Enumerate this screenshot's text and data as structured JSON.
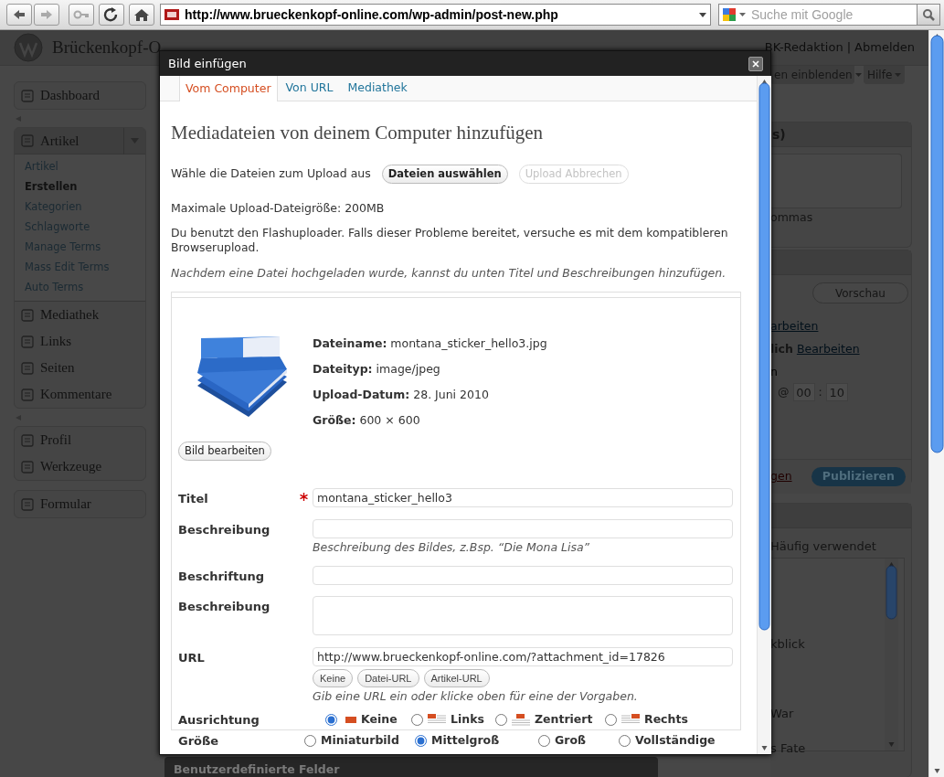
{
  "browser": {
    "buttons": [
      {
        "kind": "back",
        "disabled": false
      },
      {
        "kind": "forward",
        "disabled": true
      },
      {
        "kind": "key",
        "disabled": true
      },
      {
        "kind": "reload",
        "disabled": false
      },
      {
        "kind": "home",
        "disabled": false
      }
    ],
    "url": "http://www.brueckenkopf-online.com/wp-admin/post-new.php",
    "search_placeholder": "Suche mit Google"
  },
  "admin": {
    "site_title": "Brückenkopf-O",
    "user": "BK-Redaktion",
    "separator": "|",
    "logout": "Abmelden"
  },
  "sidebar": {
    "groups": [
      {
        "divider": true,
        "items": [
          {
            "label": "Dashboard",
            "expanded": false
          }
        ]
      },
      {
        "divider": true,
        "items": [
          {
            "label": "Artikel",
            "expanded": true,
            "submenu": [
              {
                "label": "Artikel",
                "selected": false
              },
              {
                "label": "Erstellen",
                "selected": true
              },
              {
                "label": "Kategorien",
                "selected": false
              },
              {
                "label": "Schlagworte",
                "selected": false
              },
              {
                "label": "Manage Terms",
                "selected": false
              },
              {
                "label": "Mass Edit Terms",
                "selected": false
              },
              {
                "label": "Auto Terms",
                "selected": false
              }
            ]
          },
          {
            "label": "Mediathek",
            "expanded": false
          },
          {
            "label": "Links",
            "expanded": false
          },
          {
            "label": "Seiten",
            "expanded": false
          },
          {
            "label": "Kommentare",
            "expanded": false
          }
        ]
      },
      {
        "divider": false,
        "items": [
          {
            "label": "Profil",
            "expanded": false
          },
          {
            "label": "Werkzeuge",
            "expanded": false
          }
        ]
      },
      {
        "divider": false,
        "items": [
          {
            "label": "Formular",
            "expanded": false
          }
        ]
      }
    ]
  },
  "right_column": {
    "screen_options": "en einblenden",
    "help": "Hilfe",
    "tags_box": {
      "title": "s)",
      "hint": "ommas"
    },
    "publish_box": {
      "preview_button": "Vorschau",
      "status_link": "arbeiten",
      "visibility_label": "lich",
      "visibility_link": "Bearbeiten",
      "date_label": "n",
      "time": {
        "at": "@",
        "hour": "00",
        "colon": ":",
        "minute": "10"
      },
      "delete_link": "gen",
      "publish_button": "Publizieren"
    },
    "categories_box": {
      "tab": "Häufig verwendet",
      "items": [
        "kblick",
        "War",
        "s Fate"
      ]
    }
  },
  "bottom_box": {
    "title": "Benutzerdefinierte Felder"
  },
  "dialog": {
    "title": "Bild einfügen",
    "tabs": [
      {
        "label": "Vom Computer",
        "selected": true
      },
      {
        "label": "Von URL",
        "selected": false
      },
      {
        "label": "Mediathek",
        "selected": false
      }
    ],
    "heading": "Mediadateien von deinem Computer hinzufügen",
    "upload": {
      "label": "Wähle die Dateien zum Upload aus",
      "select_button": {
        "label": "Dateien auswählen",
        "disabled": false
      },
      "cancel_button": {
        "label": "Upload Abbrechen",
        "disabled": true
      }
    },
    "max_size": "Maximale Upload-Dateigröße: 200MB",
    "flash_note": {
      "text": "Du benutzt den Flashuploader. Falls dieser Probleme bereitet, versuche es mit dem kompatibleren",
      "link": "Browserupload",
      "after": "."
    },
    "hint": "Nachdem eine Datei hochgeladen wurde, kannst du unten Titel und Beschreibungen hinzufügen.",
    "item": {
      "edit_button": "Bild bearbeiten",
      "details": [
        {
          "label": "Dateiname:",
          "value": "montana_sticker_hello3.jpg"
        },
        {
          "label": "Dateityp:",
          "value": "image/jpeg"
        },
        {
          "label": "Upload-Datum:",
          "value": "28. Juni 2010"
        },
        {
          "label": "Größe:",
          "value": "600 × 600"
        }
      ],
      "fields": [
        {
          "kind": "text",
          "label": "Titel",
          "required": true,
          "value": "montana_sticker_hello3"
        },
        {
          "kind": "text",
          "label": "Beschreibung",
          "required": false,
          "help": "Beschreibung des Bildes, z.Bsp. “Die Mona Lisa”"
        },
        {
          "kind": "text",
          "label": "Beschriftung",
          "required": false
        },
        {
          "kind": "textarea",
          "label": "Beschreibung",
          "required": false
        },
        {
          "kind": "text",
          "label": "URL",
          "required": false,
          "value": "http://www.brueckenkopf-online.com/?attachment_id=17826",
          "buttons": [
            "Keine",
            "Datei-URL",
            "Artikel-URL"
          ],
          "help": "Gib eine URL ein oder klicke oben für eine der Vorgaben."
        }
      ],
      "alignment": {
        "label": "Ausrichtung",
        "options": [
          {
            "kind": "none",
            "label": "Keine",
            "selected": true
          },
          {
            "kind": "left",
            "label": "Links",
            "selected": false
          },
          {
            "kind": "center",
            "label": "Zentriert",
            "selected": false
          },
          {
            "kind": "right",
            "label": "Rechts",
            "selected": false
          }
        ]
      },
      "size": {
        "label": "Größe",
        "options": [
          {
            "label": "Miniaturbild",
            "selected": false
          },
          {
            "label": "Mittelgroß",
            "selected": true
          },
          {
            "label": "Groß",
            "selected": false
          },
          {
            "label": "Vollständige",
            "selected": false
          }
        ]
      }
    }
  }
}
